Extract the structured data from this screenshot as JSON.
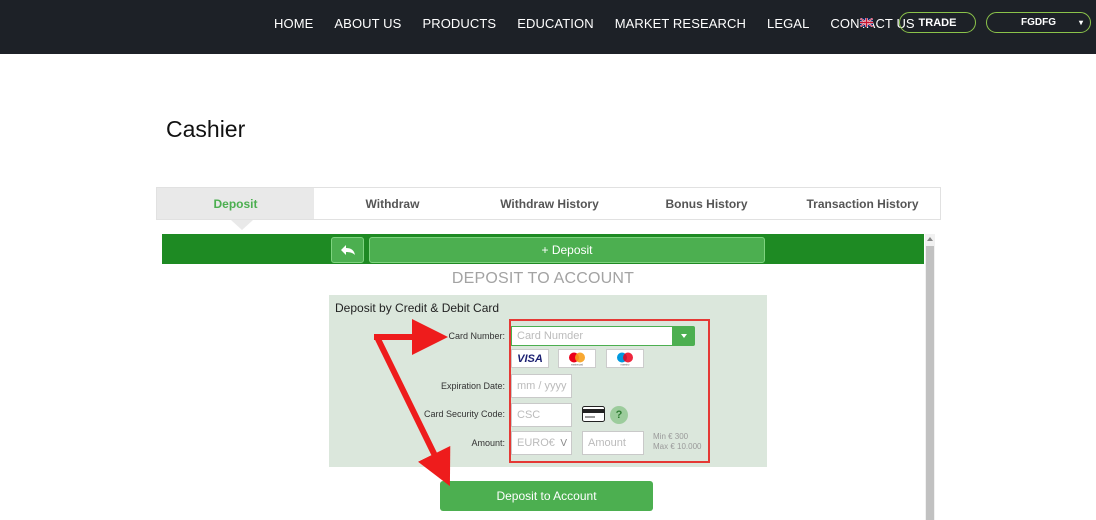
{
  "header": {
    "nav": [
      "HOME",
      "ABOUT US",
      "PRODUCTS",
      "EDUCATION",
      "MARKET RESEARCH",
      "LEGAL",
      "CONTACT US"
    ],
    "trade_label": "TRADE",
    "user_label": "FGDFG",
    "user_caret": "▾"
  },
  "page": {
    "title": "Cashier"
  },
  "tabs": [
    "Deposit",
    "Withdraw",
    "Withdraw History",
    "Bonus History",
    "Transaction History"
  ],
  "active_tab": "Deposit",
  "toolbar": {
    "back_icon": "reply-arrow-icon",
    "plus_deposit_label": "+ Deposit"
  },
  "deposit": {
    "heading": "DEPOSIT TO ACCOUNT",
    "panel_title": "Deposit by Credit & Debit Card",
    "card_number": {
      "label": "Card Number:",
      "placeholder": "Card Numder"
    },
    "card_logos": [
      "VISA",
      "mastercard",
      "maestro"
    ],
    "expiration": {
      "label": "Expiration Date:",
      "placeholder": "mm / yyyy"
    },
    "csc": {
      "label": "Card Security Code:",
      "placeholder": "CSC",
      "help": "?"
    },
    "amount": {
      "label": "Amount:",
      "currency": "EURO€",
      "currency_caret": "V",
      "placeholder": "Amount",
      "min": "Min € 300",
      "max": "Max € 10.000"
    },
    "submit_label": "Deposit to Account"
  },
  "colors": {
    "topbar": "#1d2127",
    "accent_green": "#4caf50",
    "dark_green": "#1e8a23",
    "panel_bg": "#dbe7dc",
    "annotation_red": "#e53935"
  }
}
